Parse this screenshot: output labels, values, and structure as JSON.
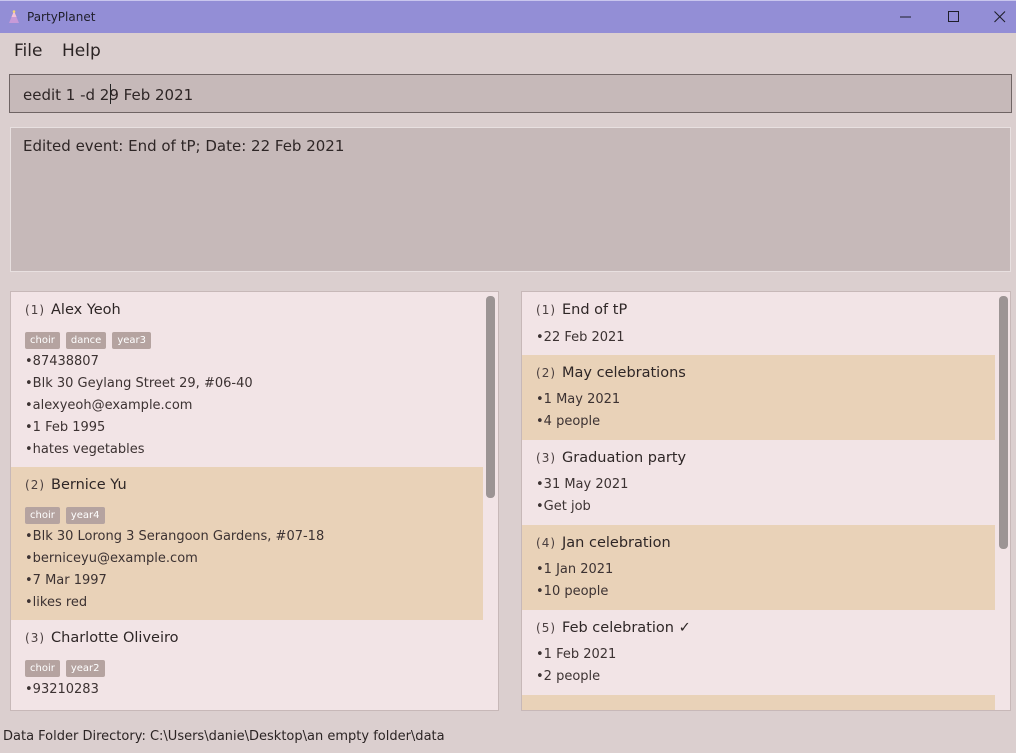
{
  "window": {
    "title": "PartyPlanet",
    "app_icon": "party-hat-icon"
  },
  "menu": {
    "file_label": "File",
    "help_label": "Help"
  },
  "command": {
    "value": "eedit 1 -d 29 Feb 2021"
  },
  "result": {
    "text": "Edited event: End of tP; Date: 22 Feb 2021"
  },
  "persons": [
    {
      "index": "1",
      "name": "Alex Yeoh",
      "tags": [
        "choir",
        "dance",
        "year3"
      ],
      "fields": [
        "•87438807",
        "•Blk 30 Geylang Street 29, #06-40",
        "•alexyeoh@example.com",
        "•1 Feb 1995",
        "•hates vegetables"
      ]
    },
    {
      "index": "2",
      "name": "Bernice Yu",
      "tags": [
        "choir",
        "year4"
      ],
      "fields": [
        "•Blk 30 Lorong 3 Serangoon Gardens, #07-18",
        "•berniceyu@example.com",
        "•7 Mar 1997",
        "•likes red"
      ]
    },
    {
      "index": "3",
      "name": "Charlotte Oliveiro",
      "tags": [
        "choir",
        "year2"
      ],
      "fields": [
        "•93210283"
      ]
    }
  ],
  "events": [
    {
      "index": "1",
      "name": "End of tP",
      "fields": [
        "•22 Feb 2021"
      ]
    },
    {
      "index": "2",
      "name": "May celebrations",
      "fields": [
        "•1 May 2021",
        "•4 people"
      ]
    },
    {
      "index": "3",
      "name": "Graduation party",
      "fields": [
        "•31 May 2021",
        "•Get job"
      ]
    },
    {
      "index": "4",
      "name": "Jan celebration",
      "fields": [
        "•1 Jan 2021",
        "•10 people"
      ]
    },
    {
      "index": "5",
      "name": "Feb celebration ✓",
      "fields": [
        "•1 Feb 2021",
        "•2 people"
      ]
    }
  ],
  "status": {
    "text": "Data Folder Directory: C:\\Users\\danie\\Desktop\\an empty folder\\data"
  },
  "colors": {
    "titlebar": "#938ed6",
    "card_alt": "#e9d2b8",
    "card": "#f2e4e6",
    "tag": "#b5a3a0"
  }
}
